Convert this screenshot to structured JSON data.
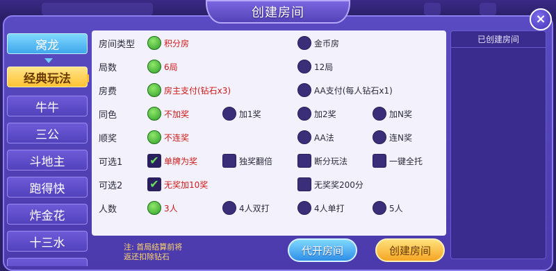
{
  "title": "创建房间",
  "close_label": "×",
  "tabs": [
    "窝龙",
    "经典玩法",
    "牛牛",
    "三公",
    "斗地主",
    "跑得快",
    "炸金花",
    "十三水"
  ],
  "right_panel_title": "已创建房间",
  "rows": [
    {
      "label": "房间类型",
      "options": [
        {
          "type": "radio",
          "text": "积分房",
          "selected": true
        },
        {
          "type": "radio",
          "text": "金币房",
          "selected": false
        }
      ]
    },
    {
      "label": "局数",
      "options": [
        {
          "type": "radio",
          "text": "6局",
          "selected": true
        },
        {
          "type": "radio",
          "text": "12局",
          "selected": false
        }
      ]
    },
    {
      "label": "房费",
      "options": [
        {
          "type": "radio",
          "text": "房主支付(钻石x3)",
          "selected": true
        },
        {
          "type": "radio",
          "text": "AA支付(每人钻石x1)",
          "selected": false
        }
      ]
    },
    {
      "label": "同色",
      "options": [
        {
          "type": "radio",
          "text": "不加奖",
          "selected": true
        },
        {
          "type": "radio",
          "text": "加1奖",
          "selected": false
        },
        {
          "type": "radio",
          "text": "加2奖",
          "selected": false
        },
        {
          "type": "radio",
          "text": "加N奖",
          "selected": false
        }
      ]
    },
    {
      "label": "顺奖",
      "options": [
        {
          "type": "radio",
          "text": "不连奖",
          "selected": true
        },
        {
          "type": "radio",
          "text": "AA法",
          "selected": false
        },
        {
          "type": "radio",
          "text": "连N奖",
          "selected": false
        }
      ]
    },
    {
      "label": "可选1",
      "options": [
        {
          "type": "check",
          "text": "单牌为奖",
          "selected": true
        },
        {
          "type": "check",
          "text": "独奖翻倍",
          "selected": false
        },
        {
          "type": "check",
          "text": "断分玩法",
          "selected": false
        },
        {
          "type": "check",
          "text": "一键全托",
          "selected": false
        }
      ]
    },
    {
      "label": "可选2",
      "options": [
        {
          "type": "check",
          "text": "无奖加10奖",
          "selected": true
        },
        {
          "type": "check",
          "text": "无奖奖200分",
          "selected": false
        }
      ]
    },
    {
      "label": "人数",
      "options": [
        {
          "type": "radio",
          "text": "3人",
          "selected": true
        },
        {
          "type": "radio",
          "text": "4人双打",
          "selected": false
        },
        {
          "type": "radio",
          "text": "4人单打",
          "selected": false
        },
        {
          "type": "radio",
          "text": "5人",
          "selected": false
        }
      ]
    }
  ],
  "note": {
    "line1": "注: 首局结算前将",
    "line2": "返还扣除钻石"
  },
  "buttons": {
    "proxy": "代开房间",
    "create": "创建房间"
  },
  "colors": {
    "accent_selected_text": "#d11a1a",
    "radio_selected": "#2f9e2a",
    "active_tab": "#ffc232"
  }
}
